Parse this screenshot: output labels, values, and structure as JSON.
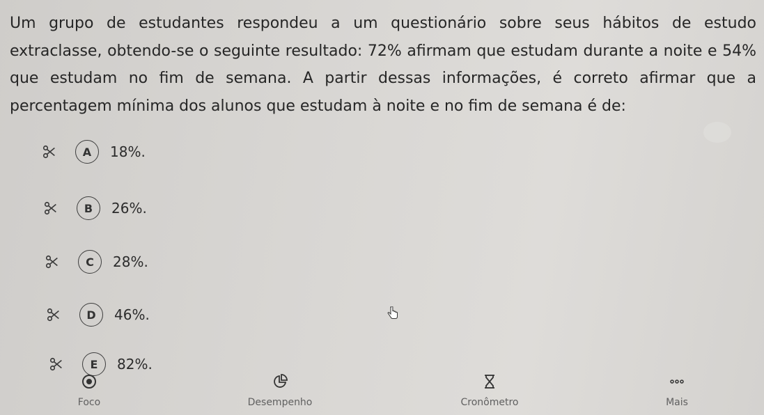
{
  "question": {
    "text": "Um grupo de estudantes respondeu a um questionário sobre seus hábitos de estudo extraclasse, obtendo-se o seguinte resultado: 72% afirmam que estudam durante a noite e 54% que estudam no fim de semana. A partir dessas informações, é correto afirmar que a percentagem mínima dos alunos que estudam à noite e no fim de semana é de:"
  },
  "options": [
    {
      "letter": "A",
      "text": "18%."
    },
    {
      "letter": "B",
      "text": "26%."
    },
    {
      "letter": "C",
      "text": "28%."
    },
    {
      "letter": "D",
      "text": "46%."
    },
    {
      "letter": "E",
      "text": "82%."
    }
  ],
  "nav": {
    "focus_label": "Foco",
    "performance_label": "Desempenho",
    "timer_label": "Cronômetro",
    "more_label": "Mais"
  },
  "icons": {
    "eliminate": "scissors-icon",
    "focus": "target-icon",
    "performance": "pie-chart-icon",
    "timer": "hourglass-icon",
    "more": "ellipsis-icon"
  }
}
